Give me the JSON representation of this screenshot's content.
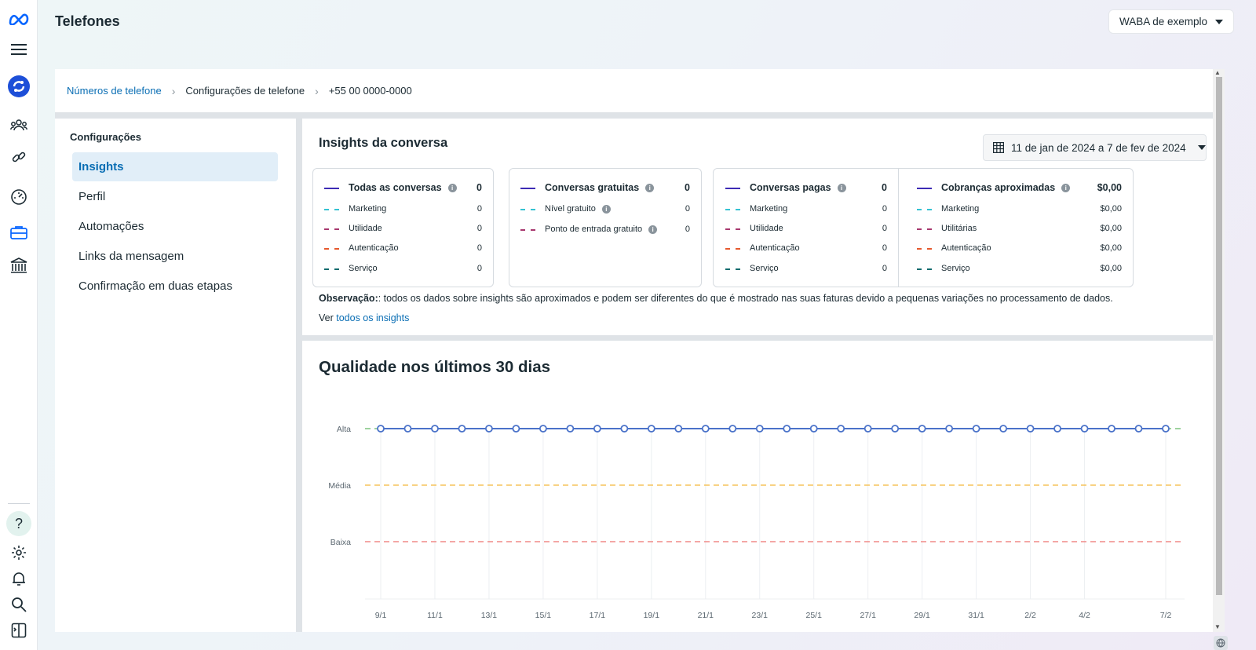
{
  "header": {
    "title": "Telefones",
    "account_selector": "WABA de exemplo"
  },
  "rail": {
    "icons": [
      "meta-logo-icon",
      "menu-icon",
      "business-app-icon",
      "people-icon",
      "link-icon",
      "dashboard-icon",
      "briefcase-icon",
      "bank-icon",
      "help-icon",
      "settings-icon",
      "bell-icon",
      "search-icon",
      "panel-icon"
    ],
    "help_glyph": "?"
  },
  "breadcrumb": {
    "items": [
      "Números de telefone",
      "Configurações de telefone",
      "+55 00 0000-0000"
    ],
    "separator": "›"
  },
  "settings": {
    "title": "Configurações",
    "items": [
      "Insights",
      "Perfil",
      "Automações",
      "Links da mensagem",
      "Confirmação em duas etapas"
    ],
    "active_index": 0
  },
  "insights": {
    "title": "Insights da conversa",
    "date_range": "11 de jan de 2024 a 7 de fev de 2024",
    "boxes": [
      {
        "header": {
          "label": "Todas as conversas",
          "value": "0",
          "info": true
        },
        "rows": [
          {
            "label": "Marketing",
            "value": "0",
            "color": "#35c2d2"
          },
          {
            "label": "Utilidade",
            "value": "0",
            "color": "#a8386e"
          },
          {
            "label": "Autenticação",
            "value": "0",
            "color": "#e6592e"
          },
          {
            "label": "Serviço",
            "value": "0",
            "color": "#116b6e"
          }
        ]
      },
      {
        "header": {
          "label": "Conversas gratuitas",
          "value": "0",
          "info": true
        },
        "rows": [
          {
            "label": "Nível gratuito",
            "value": "0",
            "color": "#35c2d2",
            "info": true
          },
          {
            "label": "Ponto de entrada gratuito",
            "value": "0",
            "color": "#a8386e",
            "info": true
          }
        ]
      },
      {
        "header": {
          "label": "Conversas pagas",
          "value": "0",
          "info": true
        },
        "rows": [
          {
            "label": "Marketing",
            "value": "0",
            "color": "#35c2d2"
          },
          {
            "label": "Utilidade",
            "value": "0",
            "color": "#a8386e"
          },
          {
            "label": "Autenticação",
            "value": "0",
            "color": "#e6592e"
          },
          {
            "label": "Serviço",
            "value": "0",
            "color": "#116b6e"
          }
        ]
      },
      {
        "header": {
          "label": "Cobranças aproximadas",
          "value": "$0,00",
          "info": true
        },
        "rows": [
          {
            "label": "Marketing",
            "value": "$0,00",
            "color": "#35c2d2"
          },
          {
            "label": "Utilitárias",
            "value": "$0,00",
            "color": "#a8386e"
          },
          {
            "label": "Autenticação",
            "value": "$0,00",
            "color": "#e6592e"
          },
          {
            "label": "Serviço",
            "value": "$0,00",
            "color": "#116b6e"
          }
        ]
      }
    ],
    "note_bold": "Observação:",
    "note_text": ": todos os dados sobre insights são aproximados e podem ser diferentes do que é mostrado nas suas faturas devido a pequenas variações no processamento de dados.",
    "see_prefix": "Ver",
    "see_link": "todos os insights",
    "series_color": "#3d2bb5"
  },
  "quality": {
    "title": "Qualidade nos últimos 30 dias"
  },
  "chart_data": {
    "type": "line",
    "title": "Qualidade nos últimos 30 dias",
    "y_levels": [
      "Baixa",
      "Média",
      "Alta"
    ],
    "threshold_colors": {
      "Alta": "#7dc37f",
      "Média": "#f5c35b",
      "Baixa": "#f08a87"
    },
    "series_color": "#4a72c9",
    "x_tick_labels": [
      "9/1",
      "11/1",
      "13/1",
      "15/1",
      "17/1",
      "19/1",
      "21/1",
      "23/1",
      "25/1",
      "27/1",
      "29/1",
      "31/1",
      "2/2",
      "4/2",
      "7/2"
    ],
    "x": [
      "9/1",
      "10/1",
      "11/1",
      "12/1",
      "13/1",
      "14/1",
      "15/1",
      "16/1",
      "17/1",
      "18/1",
      "19/1",
      "20/1",
      "21/1",
      "22/1",
      "23/1",
      "24/1",
      "25/1",
      "26/1",
      "27/1",
      "28/1",
      "29/1",
      "30/1",
      "31/1",
      "1/2",
      "2/2",
      "3/2",
      "4/2",
      "5/2",
      "6/2",
      "7/2"
    ],
    "values": [
      "Alta",
      "Alta",
      "Alta",
      "Alta",
      "Alta",
      "Alta",
      "Alta",
      "Alta",
      "Alta",
      "Alta",
      "Alta",
      "Alta",
      "Alta",
      "Alta",
      "Alta",
      "Alta",
      "Alta",
      "Alta",
      "Alta",
      "Alta",
      "Alta",
      "Alta",
      "Alta",
      "Alta",
      "Alta",
      "Alta",
      "Alta",
      "Alta",
      "Alta",
      "Alta"
    ],
    "grid": true
  }
}
